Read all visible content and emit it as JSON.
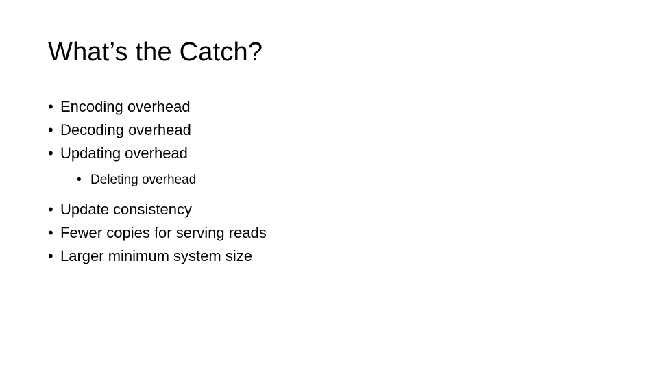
{
  "title": "What’s the Catch?",
  "bullets": {
    "b1": "Encoding overhead",
    "b2": "Decoding overhead",
    "b3": "Updating overhead",
    "b3_sub1": "Deleting overhead",
    "b4": "Update consistency",
    "b5": "Fewer copies for serving reads",
    "b6": "Larger minimum system size"
  }
}
